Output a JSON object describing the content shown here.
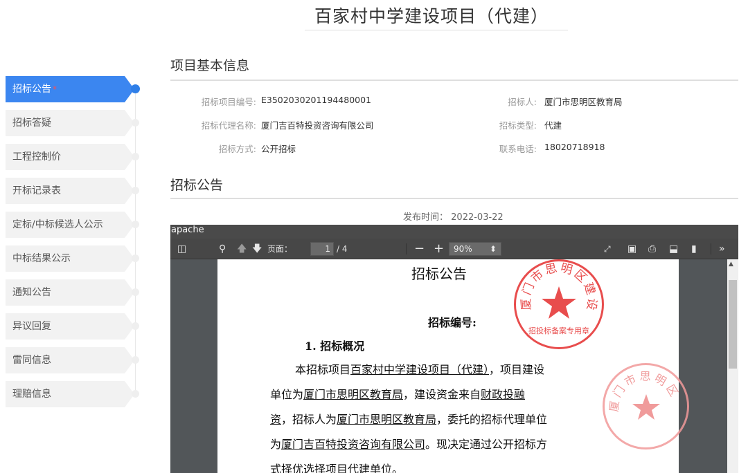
{
  "page": {
    "title": "百家村中学建设项目（代建）"
  },
  "sidebar": {
    "items": [
      {
        "label": "招标公告",
        "marker": "*",
        "active": true
      },
      {
        "label": "招标答疑"
      },
      {
        "label": "工程控制价"
      },
      {
        "label": "开标记录表"
      },
      {
        "label": "定标/中标候选人公示"
      },
      {
        "label": "中标结果公示"
      },
      {
        "label": "通知公告"
      },
      {
        "label": "异议回复"
      },
      {
        "label": "雷同信息"
      },
      {
        "label": "理赔信息"
      }
    ]
  },
  "basic_info": {
    "title": "项目基本信息",
    "project_no_label": "招标项目编号:",
    "project_no": "E3502030201194480001",
    "tenderer_label": "招标人:",
    "tenderer": "厦门市思明区教育局",
    "agency_label": "招标代理名称:",
    "agency": "厦门吉百特投资咨询有限公司",
    "type_label": "招标类型:",
    "type": "代建",
    "method_label": "招标方式:",
    "method": "公开招标",
    "phone_label": "联系电话:",
    "phone": "18020718918"
  },
  "notice": {
    "title": "招标公告",
    "publish_label": "发布时间：",
    "publish_date": "2022-03-22"
  },
  "viewer": {
    "header_text": "apache",
    "page_label": "页面：",
    "page_current": "1",
    "page_total": "/ 4",
    "zoom": "90%",
    "icons": [
      "sidebar-toggle-icon",
      "search-icon",
      "prev-page-icon",
      "next-page-icon",
      "zoom-out-icon",
      "zoom-in-icon",
      "presentation-icon",
      "open-file-icon",
      "print-icon",
      "download-icon",
      "bookmark-icon",
      "more-tools-icon"
    ]
  },
  "document": {
    "title": "招标公告",
    "bid_no_label": "招标编号:",
    "section1": "1. 招标概况",
    "p1_a": "本招标项目",
    "p1_project": "百家村中学建设项目（代建）",
    "p1_b": "，项目建设",
    "p2_a": "单位为",
    "p2_unit": "厦门市思明区教育局",
    "p2_b": "，建设资金来自",
    "p2_fund": "财政投融",
    "p3_fund": "资",
    "p3_a": "，招标人为",
    "p3_tenderer": "厦门市思明区教育局",
    "p3_b": "，委托的招标代理单位",
    "p4_a": "为",
    "p4_agency": "厦门吉百特投资咨询有限公司",
    "p4_b": "。现决定通过公开招标方",
    "p5": "式择优选择项目代建单位。",
    "stamp1_text": "厦门市思明区建设局",
    "stamp1_sub": "招投标备案专用章",
    "stamp2_text": "厦门市思明区"
  },
  "colors": {
    "accent": "#3b86f0",
    "stamp": "#e84d4d"
  }
}
